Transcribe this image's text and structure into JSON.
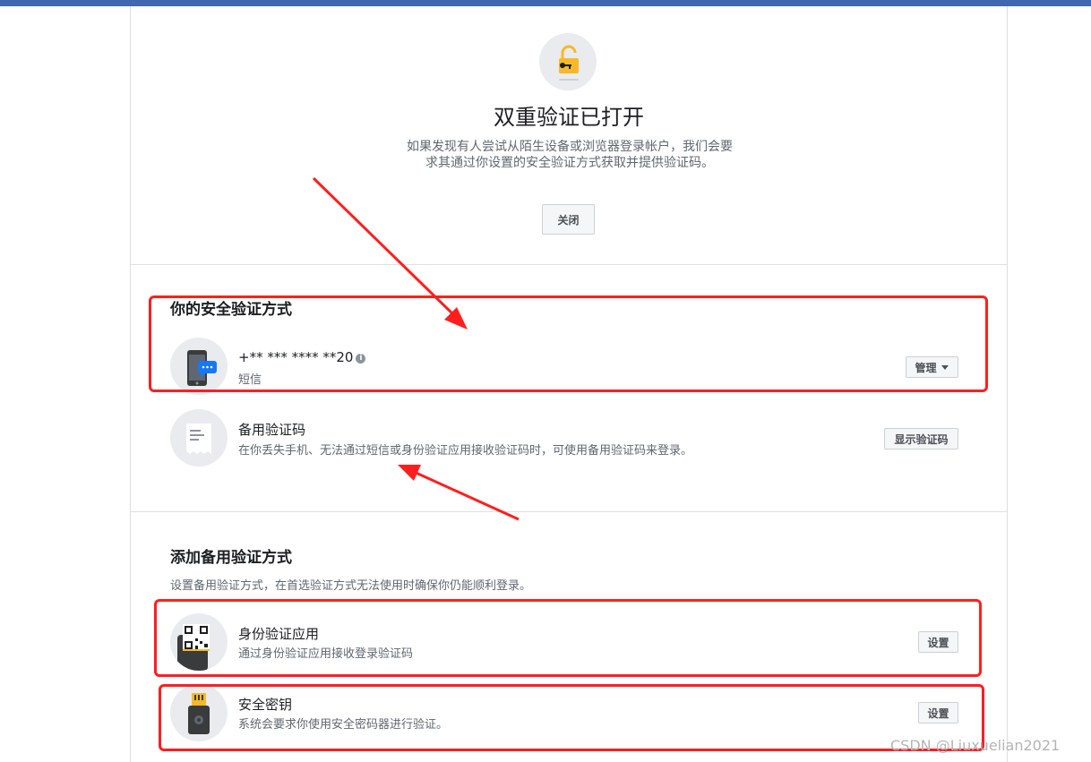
{
  "colors": {
    "topbar": "#4267b2",
    "annotation": "#ff1e1e",
    "accent_blue": "#1877f2"
  },
  "header": {
    "icon": "lock-open-key-icon",
    "title": "双重验证已打开",
    "description": "如果发现有人尝试从陌生设备或浏览器登录帐户，我们会要求其通过你设置的安全验证方式获取并提供验证码。",
    "close_label": "关闭"
  },
  "methods": {
    "title": "你的安全验证方式",
    "sms": {
      "icon": "phone-message-icon",
      "number": "+** *** **** **20",
      "info_icon": "info-icon",
      "type": "短信",
      "manage_label": "管理"
    },
    "recovery": {
      "icon": "recovery-codes-icon",
      "title": "备用验证码",
      "description": "在你丢失手机、无法通过短信或身份验证应用接收验证码时，可使用备用验证码来登录。",
      "button_label": "显示验证码"
    }
  },
  "backup": {
    "title": "添加备用验证方式",
    "description": "设置备用验证方式，在首选验证方式无法使用时确保你仍能顺利登录。",
    "auth_app": {
      "icon": "qr-code-icon",
      "title": "身份验证应用",
      "description": "通过身份验证应用接收登录验证码",
      "button_label": "设置"
    },
    "security_key": {
      "icon": "usb-key-icon",
      "title": "安全密钥",
      "description": "系统会要求你使用安全密码器进行验证。",
      "button_label": "设置"
    }
  },
  "watermark": "CSDN @Liuxuelian2021"
}
